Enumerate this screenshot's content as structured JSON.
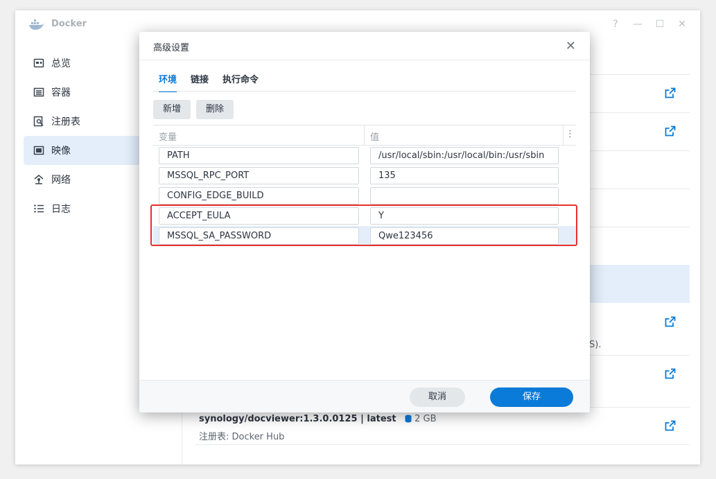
{
  "app": {
    "title": "Docker"
  },
  "window_controls": {
    "help": "?",
    "minimize": "—",
    "maximize": "☐",
    "close": "✕"
  },
  "sidebar": {
    "items": [
      {
        "label": "总览",
        "icon": "overview-icon"
      },
      {
        "label": "容器",
        "icon": "container-icon"
      },
      {
        "label": "注册表",
        "icon": "registry-icon"
      },
      {
        "label": "映像",
        "icon": "image-icon",
        "active": true
      },
      {
        "label": "网络",
        "icon": "network-icon"
      },
      {
        "label": "日志",
        "icon": "log-icon"
      }
    ]
  },
  "background_list": {
    "partial_text": "S).",
    "bottom_item": {
      "title": "synology/docviewer:1.3.0.0125 | latest",
      "size": "2 GB",
      "registry": "注册表: Docker Hub"
    }
  },
  "dialog": {
    "title": "高级设置",
    "tabs": [
      {
        "label": "环境",
        "active": true
      },
      {
        "label": "链接"
      },
      {
        "label": "执行命令"
      }
    ],
    "buttons": {
      "add": "新增",
      "delete": "删除",
      "cancel": "取消",
      "save": "保存"
    },
    "table": {
      "headers": {
        "variable": "变量",
        "value": "值"
      },
      "rows": [
        {
          "name": "PATH",
          "value": "/usr/local/sbin:/usr/local/bin:/usr/sbin"
        },
        {
          "name": "MSSQL_RPC_PORT",
          "value": "135"
        },
        {
          "name": "CONFIG_EDGE_BUILD",
          "value": ""
        },
        {
          "name": "ACCEPT_EULA",
          "value": "Y"
        },
        {
          "name": "MSSQL_SA_PASSWORD",
          "value": "Qwe123456",
          "selected": true
        }
      ]
    }
  },
  "colors": {
    "accent": "#0a7bd8",
    "highlight_box": "#e8302d",
    "selected_row": "#e4eefb"
  }
}
